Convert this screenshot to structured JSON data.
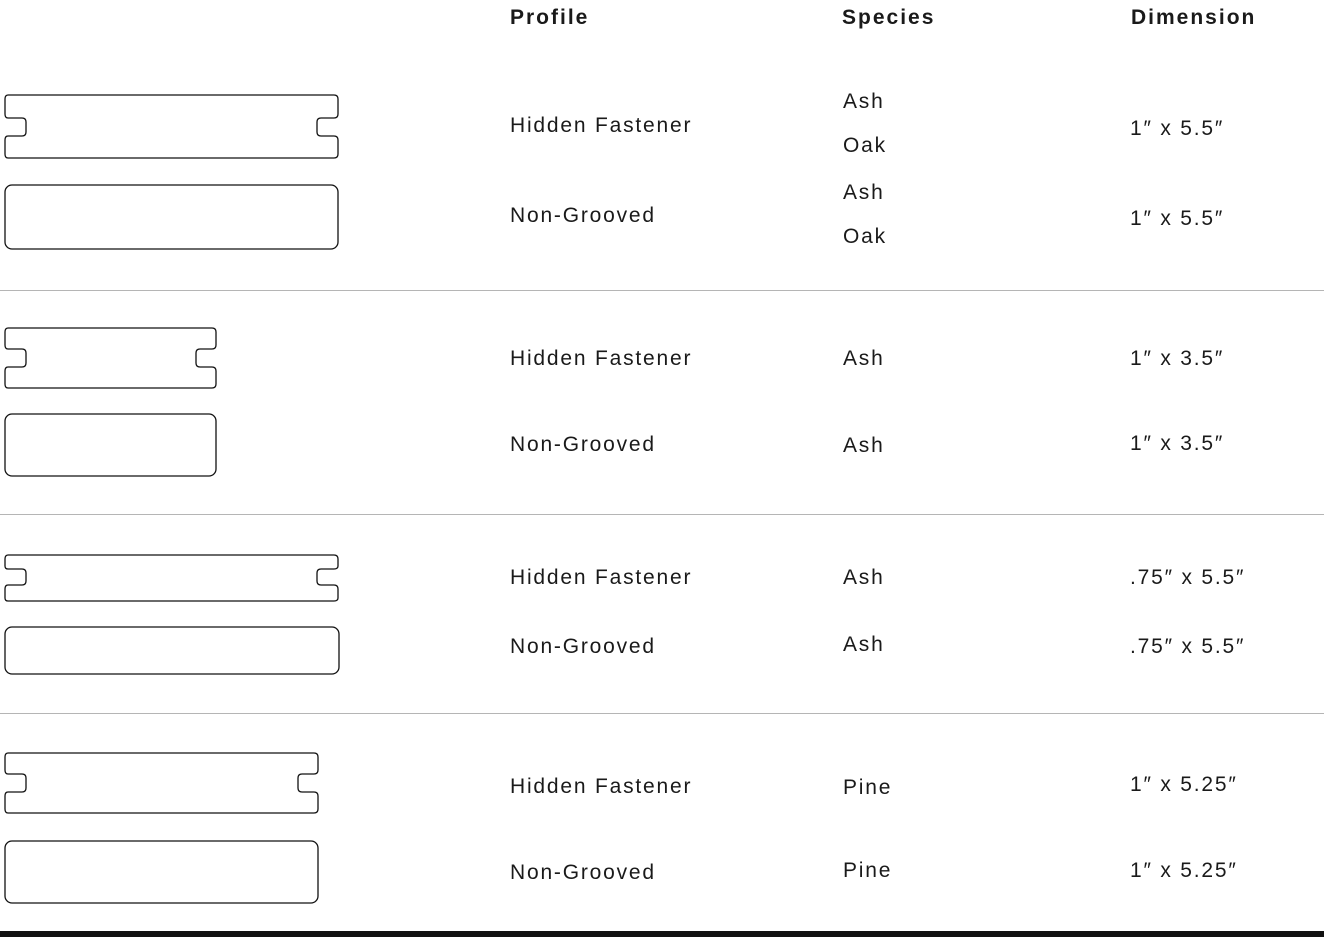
{
  "headers": {
    "profile": "Profile",
    "species": "Species",
    "dimension": "Dimension"
  },
  "groups": [
    {
      "rows": [
        {
          "profile": "Hidden Fastener",
          "species": [
            "Ash",
            "Oak"
          ],
          "dimension": "1″ x 5.5″"
        },
        {
          "profile": "Non-Grooved",
          "species": [
            "Ash",
            "Oak"
          ],
          "dimension": "1″ x 5.5″"
        }
      ]
    },
    {
      "rows": [
        {
          "profile": "Hidden Fastener",
          "species": [
            "Ash"
          ],
          "dimension": "1″ x 3.5″"
        },
        {
          "profile": "Non-Grooved",
          "species": [
            "Ash"
          ],
          "dimension": "1″ x 3.5″"
        }
      ]
    },
    {
      "rows": [
        {
          "profile": "Hidden Fastener",
          "species": [
            "Ash"
          ],
          "dimension": ".75″ x 5.5″"
        },
        {
          "profile": "Non-Grooved",
          "species": [
            "Ash"
          ],
          "dimension": ".75″ x 5.5″"
        }
      ]
    },
    {
      "rows": [
        {
          "profile": "Hidden Fastener",
          "species": [
            "Pine"
          ],
          "dimension": "1″ x 5.25″"
        },
        {
          "profile": "Non-Grooved",
          "species": [
            "Pine"
          ],
          "dimension": "1″ x 5.25″"
        }
      ]
    }
  ]
}
